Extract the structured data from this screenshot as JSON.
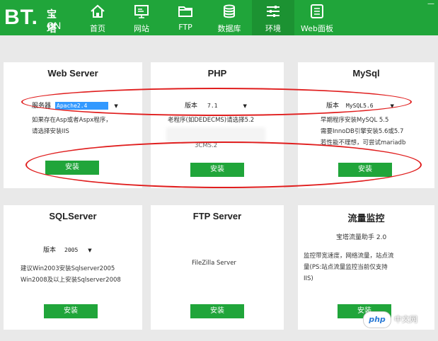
{
  "logo": {
    "main": "BT.",
    "cn_top": "宝塔",
    "cn_bottom": "CN"
  },
  "nav": [
    {
      "label": "首页",
      "icon": "home-icon"
    },
    {
      "label": "网站",
      "icon": "monitor-icon"
    },
    {
      "label": "FTP",
      "icon": "folder-icon"
    },
    {
      "label": "数据库",
      "icon": "database-icon"
    },
    {
      "label": "环境",
      "icon": "sliders-icon",
      "active": true
    },
    {
      "label": "Web面板",
      "icon": "panel-list-icon"
    }
  ],
  "cards": {
    "webserver": {
      "title": "Web Server",
      "select_label": "服务器",
      "select_value": "Apache2.4",
      "desc": [
        "如果存在Asp或者Aspx程序，",
        "请选择安装IIS"
      ],
      "button": "安装"
    },
    "php": {
      "title": "PHP",
      "select_label": "版本",
      "select_value": "7.1",
      "desc": [
        "老程序(如DEDECMS)请选择5.2"
      ],
      "desc_tail": "3CMS.2",
      "button": "安装"
    },
    "mysql": {
      "title": "MySql",
      "select_label": "版本",
      "select_value": "MySQL5.6",
      "desc": [
        "早期程序安装MySQL 5.5",
        "需要InnoDB引擎安装5.6或5.7",
        "若性能不理想，可尝试mariadb"
      ],
      "button": "安装"
    },
    "sqlserver": {
      "title": "SQLServer",
      "select_label": "版本",
      "select_value": "2005",
      "desc": [
        "建议Win2003安装Sqlserver2005",
        "Win2008及以上安装Sqlserver2008"
      ],
      "button": "安装"
    },
    "ftp": {
      "title": "FTP Server",
      "desc": [
        "FileZilla Server"
      ],
      "button": "安装"
    },
    "monitor": {
      "title": "流量监控",
      "subtitle": "宝塔流量助手 2.0",
      "desc": [
        "监控带宽速度，网络流量，站点流",
        "量(PS:站点流量监控当前仅支持",
        "IIS)"
      ],
      "button": "安装"
    }
  },
  "watermark": {
    "pill": "php",
    "text": "中文网"
  },
  "colors": {
    "brand": "#20a53a",
    "annotation": "#e01e1e",
    "selection": "#3399ff"
  }
}
